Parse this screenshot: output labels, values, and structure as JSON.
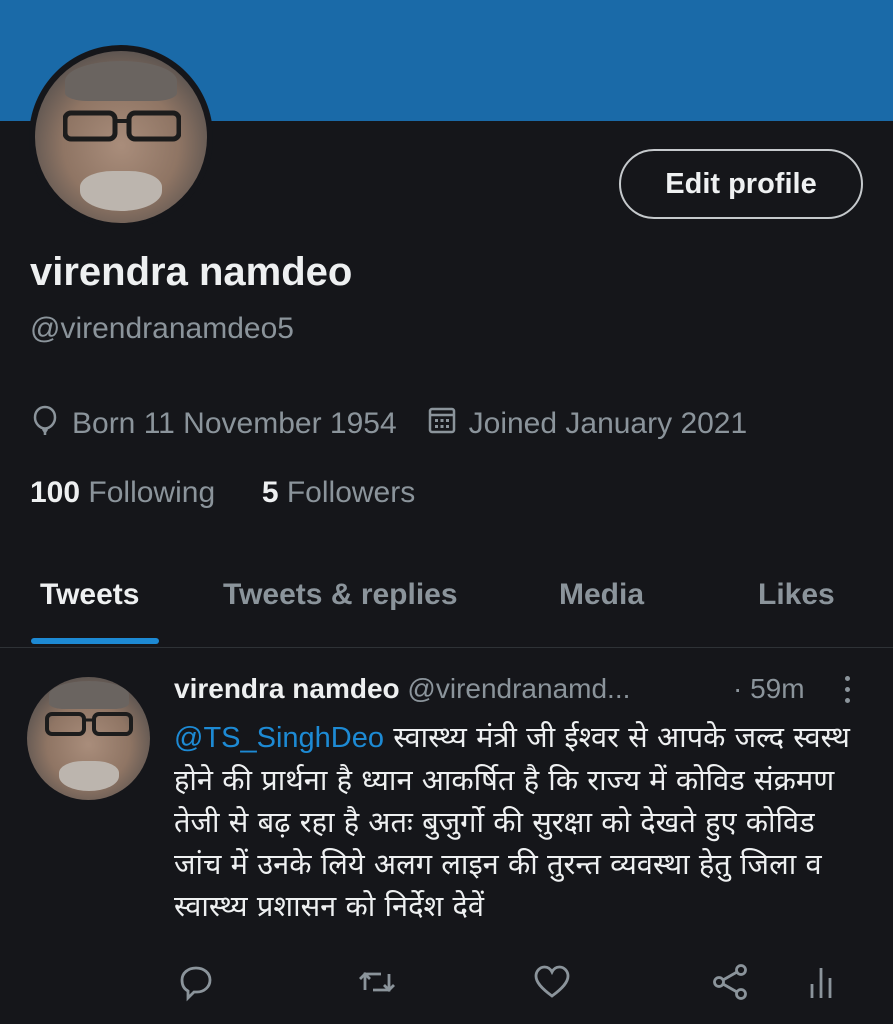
{
  "profile": {
    "name": "virendra namdeo",
    "handle": "@virendranamdeo5",
    "edit_label": "Edit profile",
    "born": "Born 11 November 1954",
    "joined": "Joined January 2021",
    "following_count": "100",
    "following_label": "Following",
    "followers_count": "5",
    "followers_label": "Followers"
  },
  "tabs": [
    {
      "label": "Tweets",
      "active": true
    },
    {
      "label": "Tweets & replies",
      "active": false
    },
    {
      "label": "Media",
      "active": false
    },
    {
      "label": "Likes",
      "active": false
    }
  ],
  "tweet": {
    "name": "virendra namdeo",
    "handle": "@virendranamd...",
    "time": "· 59m",
    "mention": "@TS_SinghDeo",
    "text": "स्वास्थ्य मंत्री जी ईश्वर से आपके जल्द स्वस्थ होने की प्रार्थना है ध्यान आकर्षित है कि राज्य में कोविड संक्रमण तेजी से बढ़ रहा है अतः बुजुर्गो की सुरक्षा को देखते हुए कोविड जांच में उनके लिये अलग लाइन की तुरन्त व्यवस्था हेतु जिला व स्वास्थ्य प्रशासन को निर्देश देवें"
  },
  "icons": {
    "born": "balloon-icon",
    "joined": "calendar-icon",
    "reply": "reply-icon",
    "retweet": "retweet-icon",
    "like": "heart-icon",
    "share": "share-icon",
    "analytics": "analytics-icon",
    "more": "more-vertical-icon"
  },
  "colors": {
    "banner": "#1a6aa8",
    "background": "#15161a",
    "accent": "#1d8ad4",
    "muted": "#8b949b"
  }
}
